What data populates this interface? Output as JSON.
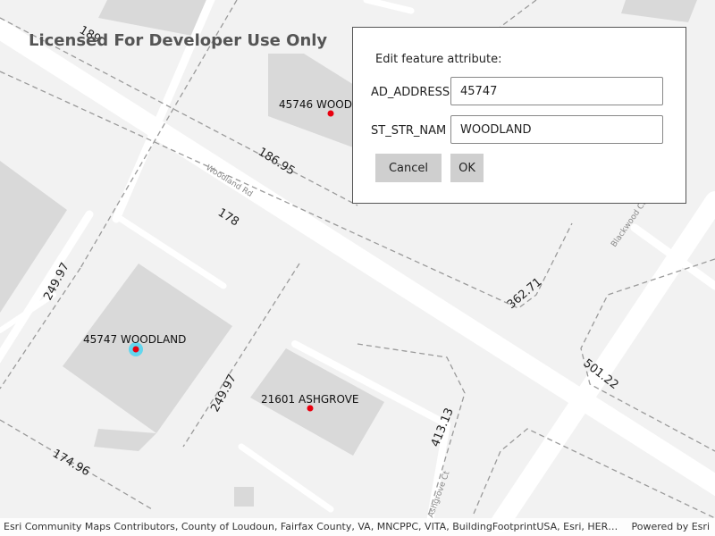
{
  "watermark": "Licensed For Developer Use Only",
  "dialog": {
    "title": "Edit feature attribute:",
    "fields": [
      {
        "label": "AD_ADDRESS",
        "value": "45747"
      },
      {
        "label": "ST_STR_NAM",
        "value": "WOODLAND"
      }
    ],
    "cancel_label": "Cancel",
    "ok_label": "OK"
  },
  "map": {
    "road_labels": [
      "Woodland Rd",
      "Blackwood Ct",
      "Ashgrove Ct"
    ],
    "dimension_labels": [
      "186.95",
      "178",
      "249.97",
      "249.97",
      "362.71",
      "501.22",
      "413.13",
      "174.96",
      "189"
    ],
    "point_labels": [
      "45746 WOOD",
      "45747 WOODLAND",
      "21601 ASHGROVE"
    ],
    "selected_feature": "45747 WOODLAND",
    "colors": {
      "point": "#e8000f",
      "selection": "#00d4ff",
      "building": "#d9d9d9",
      "road": "#ffffff",
      "parcel_line": "#9a9a9a"
    }
  },
  "attribution": {
    "text": "Esri Community Maps Contributors, County of Loudoun, Fairfax County, VA, MNCPPC, VITA, BuildingFootprintUSA, Esri, HERE, Garmin",
    "powered_by": "Powered by Esri"
  }
}
